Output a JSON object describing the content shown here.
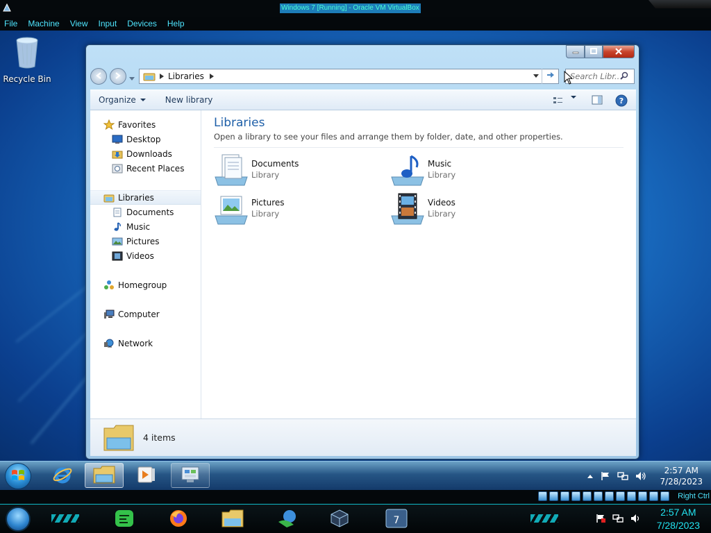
{
  "vbox": {
    "title": "Windows 7 [Running] - Oracle VM VirtualBox",
    "menu": [
      "File",
      "Machine",
      "View",
      "Input",
      "Devices",
      "Help"
    ],
    "host_key": "Right Ctrl"
  },
  "desktop": {
    "recycle_bin_label": "Recycle Bin"
  },
  "explorer": {
    "breadcrumb": [
      "Libraries"
    ],
    "search_placeholder": "Search Libr...",
    "toolbar": {
      "organize_label": "Organize",
      "new_library_label": "New library"
    },
    "navpane": {
      "favorites": "Favorites",
      "favorites_items": [
        "Desktop",
        "Downloads",
        "Recent Places"
      ],
      "libraries": "Libraries",
      "libraries_items": [
        "Documents",
        "Music",
        "Pictures",
        "Videos"
      ],
      "homegroup": "Homegroup",
      "computer": "Computer",
      "network": "Network"
    },
    "main": {
      "title": "Libraries",
      "description": "Open a library to see your files and arrange them by folder, date, and other properties.",
      "items": [
        {
          "name": "Documents",
          "type": "Library",
          "icon": "documents-library-icon"
        },
        {
          "name": "Music",
          "type": "Library",
          "icon": "music-library-icon"
        },
        {
          "name": "Pictures",
          "type": "Library",
          "icon": "pictures-library-icon"
        },
        {
          "name": "Videos",
          "type": "Library",
          "icon": "videos-library-icon"
        }
      ]
    },
    "details": {
      "count": "4 items"
    }
  },
  "guest_taskbar": {
    "time": "2:57 AM",
    "date": "7/28/2023"
  },
  "host_taskbar": {
    "time": "2:57 AM",
    "date": "7/28/2023"
  },
  "colors": {
    "vbox_text": "#4fe6ff",
    "library_title": "#1e5fa8",
    "host_accent": "#14d2e0"
  }
}
